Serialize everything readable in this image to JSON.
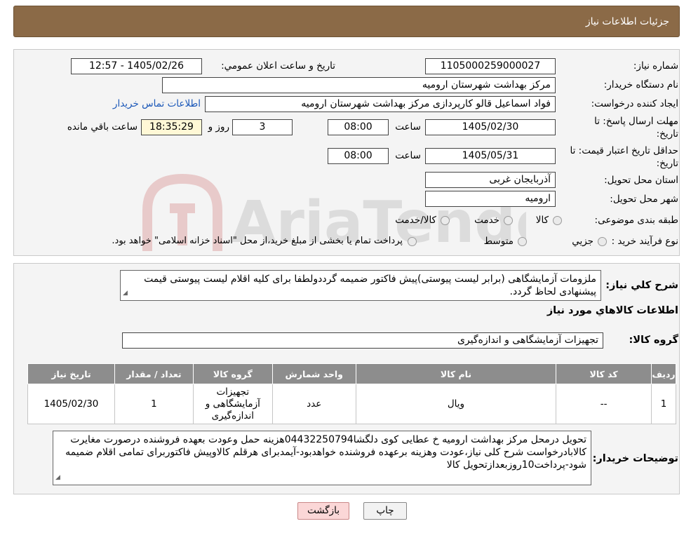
{
  "header": {
    "title": "جزئیات اطلاعات نیاز"
  },
  "form": {
    "need_number_label": "شماره نیاز:",
    "need_number": "1105000259000027",
    "announce_label": "تاریخ و ساعت اعلان عمومي:",
    "announce_value": "1405/02/26 - 12:57",
    "buyer_org_label": "نام دستگاه خريدار:",
    "buyer_org": "مرکز بهداشت شهرستان ارومیه",
    "requester_label": "ايجاد کننده درخواست:",
    "requester": "فواد اسماعیل قالو کارپردازی مرکز بهداشت شهرستان ارومیه",
    "contact_link": "اطلاعات تماس خريدار",
    "deadline_label_1": "مهلت ارسال پاسخ: تا",
    "deadline_label_2": "تاريخ:",
    "deadline_date": "1405/02/30",
    "time_label": "ساعت",
    "deadline_time": "08:00",
    "days_value": "3",
    "days_label": "روز و",
    "remaining_time": "18:35:29",
    "remaining_label": "ساعت باقي مانده",
    "validity_label_1": "حداقل تاريخ اعتبار قيمت: تا",
    "validity_label_2": "تاريخ:",
    "validity_date": "1405/05/31",
    "validity_time": "08:00",
    "province_label": "استان محل تحويل:",
    "province": "آذربایجان غربی",
    "city_label": "شهر محل تحويل:",
    "city": "ارومیه",
    "category_label": "طبقه بندی موضوعی:",
    "category_options": [
      "کالا",
      "خدمت",
      "کالا/خدمت"
    ],
    "process_label": "نوع فرآيند خريد :",
    "process_options": [
      "جزيي",
      "متوسط"
    ],
    "process_note": "پرداخت تمام يا بخشی از مبلغ خريد،از محل \"اسناد خزانه اسلامی\" خواهد بود."
  },
  "description": {
    "label": "شرح كلي نياز:",
    "text": "ملزومات آزمایشگاهی (برابر لیست پیوستی)پیش فاکتور ضمیمه گرددولطفا برای کلیه اقلام لیست پیوستی قیمت پیشنهادی لحاظ گردد."
  },
  "goods": {
    "section_title": "اطلاعات کالاهاي مورد نياز",
    "group_label": "گروه کالا:",
    "group_value": "تجهیزات آزمایشگاهی و اندازه‌گیری",
    "columns": [
      "رديف",
      "کد کالا",
      "نام کالا",
      "واحد شمارش",
      "گروه کالا",
      "تعداد / مقدار",
      "تاریخ نیاز"
    ],
    "rows": [
      [
        "1",
        "--",
        "ویال",
        "عدد",
        "تجهیزات آزمایشگاهی و اندازه‌گیری",
        "1",
        "1405/02/30"
      ]
    ]
  },
  "buyer_notes": {
    "label": "توضیحات خریدار:",
    "text": "تحویل درمحل مرکز بهداشت ارومیه خ عطایی کوی دلگشا04432250794هزینه حمل وعودت بعهده فروشنده درصورت مغایرت کالابادرخواست شرح کلی نیاز،عودت وهزینه برعهده فروشنده خواهدبود-آیمدبرای هرقلم کالاوپیش فاکتوربرای تمامی اقلام ضمیمه شود-پرداخت10روزبعدازتحویل کالا"
  },
  "buttons": {
    "print": "چاپ",
    "back": "بازگشت"
  },
  "watermark": {
    "text": "AriaTender.neT"
  },
  "colors": {
    "header_bg": "#8b6a47",
    "table_header_bg": "#8d8d8d",
    "link": "#1a57b8",
    "back_btn_bg": "#fbd7d7"
  }
}
